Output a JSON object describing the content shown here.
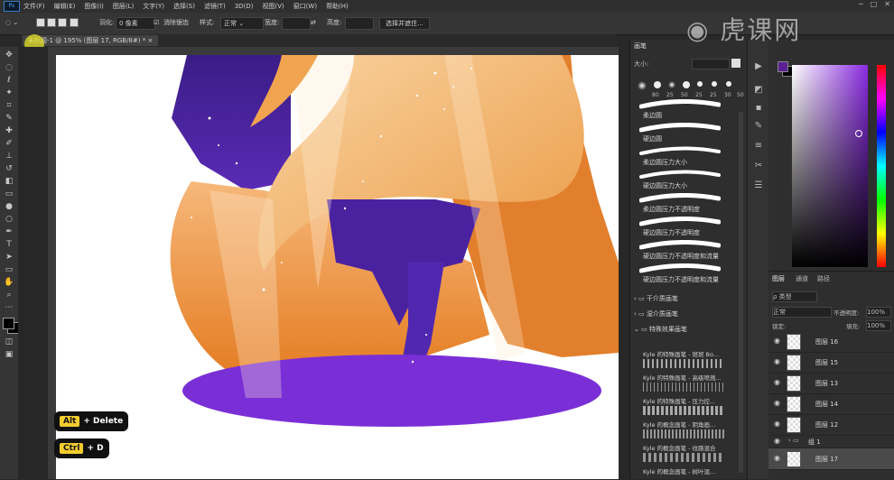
{
  "menubar": {
    "logo": "Ps",
    "items": [
      "文件(F)",
      "编辑(E)",
      "图像(I)",
      "图层(L)",
      "文字(Y)",
      "选择(S)",
      "滤镜(T)",
      "3D(D)",
      "视图(V)",
      "窗口(W)",
      "帮助(H)"
    ]
  },
  "options": {
    "feather_label": "羽化:",
    "feather_value": "0 像素",
    "antialias_label": "消除锯齿",
    "style_label": "样式:",
    "style_value": "正常",
    "width_label": "宽度:",
    "height_label": "高度:",
    "select_mask_button": "选择并遮住..."
  },
  "document": {
    "tab_title": "未标题-1 @ 195% (图层 17, RGB/8#) *"
  },
  "colors": {
    "foreground": "#5a1f95",
    "background": "#000000",
    "accent": "#f3cc2f"
  },
  "brush_panel": {
    "title": "画笔",
    "size_label": "大小:",
    "preset_sizes": [
      "80",
      "25",
      "50",
      "25",
      "25",
      "30",
      "50"
    ],
    "brushes": [
      "柔边圆",
      "硬边圆",
      "柔边圆压力大小",
      "硬边圆压力大小",
      "柔边圆压力不透明度",
      "硬边圆压力不透明度",
      "硬边圆压力不透明度和流量",
      "硬边圆压力不透明度和流量"
    ],
    "folders": [
      "干介质画笔",
      "湿介质画笔",
      "特殊效果画笔"
    ],
    "kyle_brushes": [
      "Kyle 的特殊画笔 - 斑斑 Bo...",
      "Kyle 的特殊画笔 - 高级喷溅...",
      "Kyle 的特殊画笔 - 压力控...",
      "Kyle 的概念画笔 - 阴角画...",
      "Kyle 的概念画笔 - 纹路混合",
      "Kyle 的概念画笔 - 树叶混..."
    ]
  },
  "layers_panel": {
    "tabs": [
      "图层",
      "通道",
      "路径"
    ],
    "filter_label": "ρ 类型",
    "blend_mode": "正常",
    "opacity_label": "不透明度:",
    "opacity_value": "100%",
    "lock_label": "锁定:",
    "fill_label": "填充:",
    "fill_value": "100%",
    "layers": [
      {
        "name": "图层 16",
        "visible": true,
        "selected": false
      },
      {
        "name": "图层 15",
        "visible": true,
        "selected": false
      },
      {
        "name": "图层 13",
        "visible": true,
        "selected": false
      },
      {
        "name": "图层 14",
        "visible": true,
        "selected": false
      },
      {
        "name": "图层 12",
        "visible": true,
        "selected": false
      },
      {
        "name": "组 1",
        "visible": true,
        "selected": false
      },
      {
        "name": "图层 17",
        "visible": true,
        "selected": true
      }
    ]
  },
  "shortcuts": [
    {
      "key": "Alt",
      "text": "+ Delete"
    },
    {
      "key": "Ctrl",
      "text": "+ D"
    }
  ],
  "watermark": "虎课网"
}
